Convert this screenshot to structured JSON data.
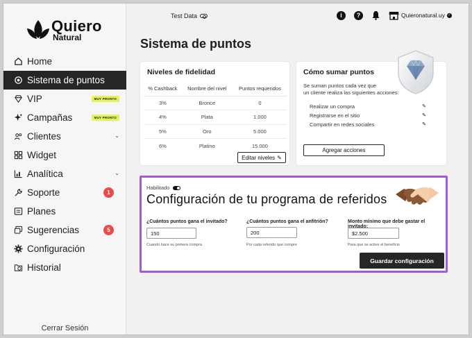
{
  "brand": {
    "name": "Quiero",
    "tagline": "Natural"
  },
  "sidebar": {
    "items": [
      {
        "label": "Home",
        "icon": "home-icon"
      },
      {
        "label": "Sistema de puntos",
        "icon": "points-icon",
        "active": true
      },
      {
        "label": "VIP",
        "icon": "diamond-icon",
        "badge": "MUY PRONTO"
      },
      {
        "label": "Campañas",
        "icon": "sparkle-icon",
        "badge": "MUY PRONTO"
      },
      {
        "label": "Clientes",
        "icon": "users-icon"
      },
      {
        "label": "Widget",
        "icon": "grid-icon"
      },
      {
        "label": "Analítica",
        "icon": "bar-chart-icon"
      },
      {
        "label": "Soporte",
        "icon": "wrench-icon",
        "count": "1"
      },
      {
        "label": "Planes",
        "icon": "list-icon"
      },
      {
        "label": "Sugerencias",
        "icon": "chat-icon",
        "count": "5"
      },
      {
        "label": "Configuración",
        "icon": "gear-icon"
      },
      {
        "label": "Historial",
        "icon": "folder-clock-icon"
      }
    ],
    "logout": "Cerrar Sesión"
  },
  "topbar": {
    "test_data": "Test Data",
    "store": "Quieronatural.uy"
  },
  "page_title": "Sistema de puntos",
  "levels": {
    "title": "Niveles de fidelidad",
    "headers": [
      "% Cashback",
      "Nombre del nivel",
      "Puntos requeridos"
    ],
    "rows": [
      [
        "3%",
        "Bronce",
        "0"
      ],
      [
        "4%",
        "Plata",
        "1.000"
      ],
      [
        "5%",
        "Oro",
        "5.000"
      ],
      [
        "6%",
        "Platino",
        "15.000"
      ]
    ],
    "edit_label": "Editar niveles"
  },
  "earn": {
    "title": "Cómo sumar puntos",
    "description_line1": "Se suman puntos cada vez que",
    "description_line2": "un cliente realiza las siguientes acciones:",
    "actions": [
      "Realizar un compra",
      "Registrarse en el sitio",
      "Compartir en redes sociales"
    ],
    "add_label": "Agregar acciones"
  },
  "referral": {
    "enabled_label": "Habilitado",
    "title": "Configuración de tu programa de referidos",
    "fields": [
      {
        "label": "¿Cuántos puntos gana el invitado?",
        "value": "150",
        "help": "Cuando hace su primera compra"
      },
      {
        "label": "¿Cuántos puntos gana el anfitrión?",
        "value": "200",
        "help": "Por cada referido que compre"
      },
      {
        "label": "Monto mínimo que debe gastar el invitado:",
        "value": "$2.500",
        "help": "Para que se active el beneficio"
      }
    ],
    "save_label": "Guardar configuración",
    "accent": "#a25bd8"
  }
}
